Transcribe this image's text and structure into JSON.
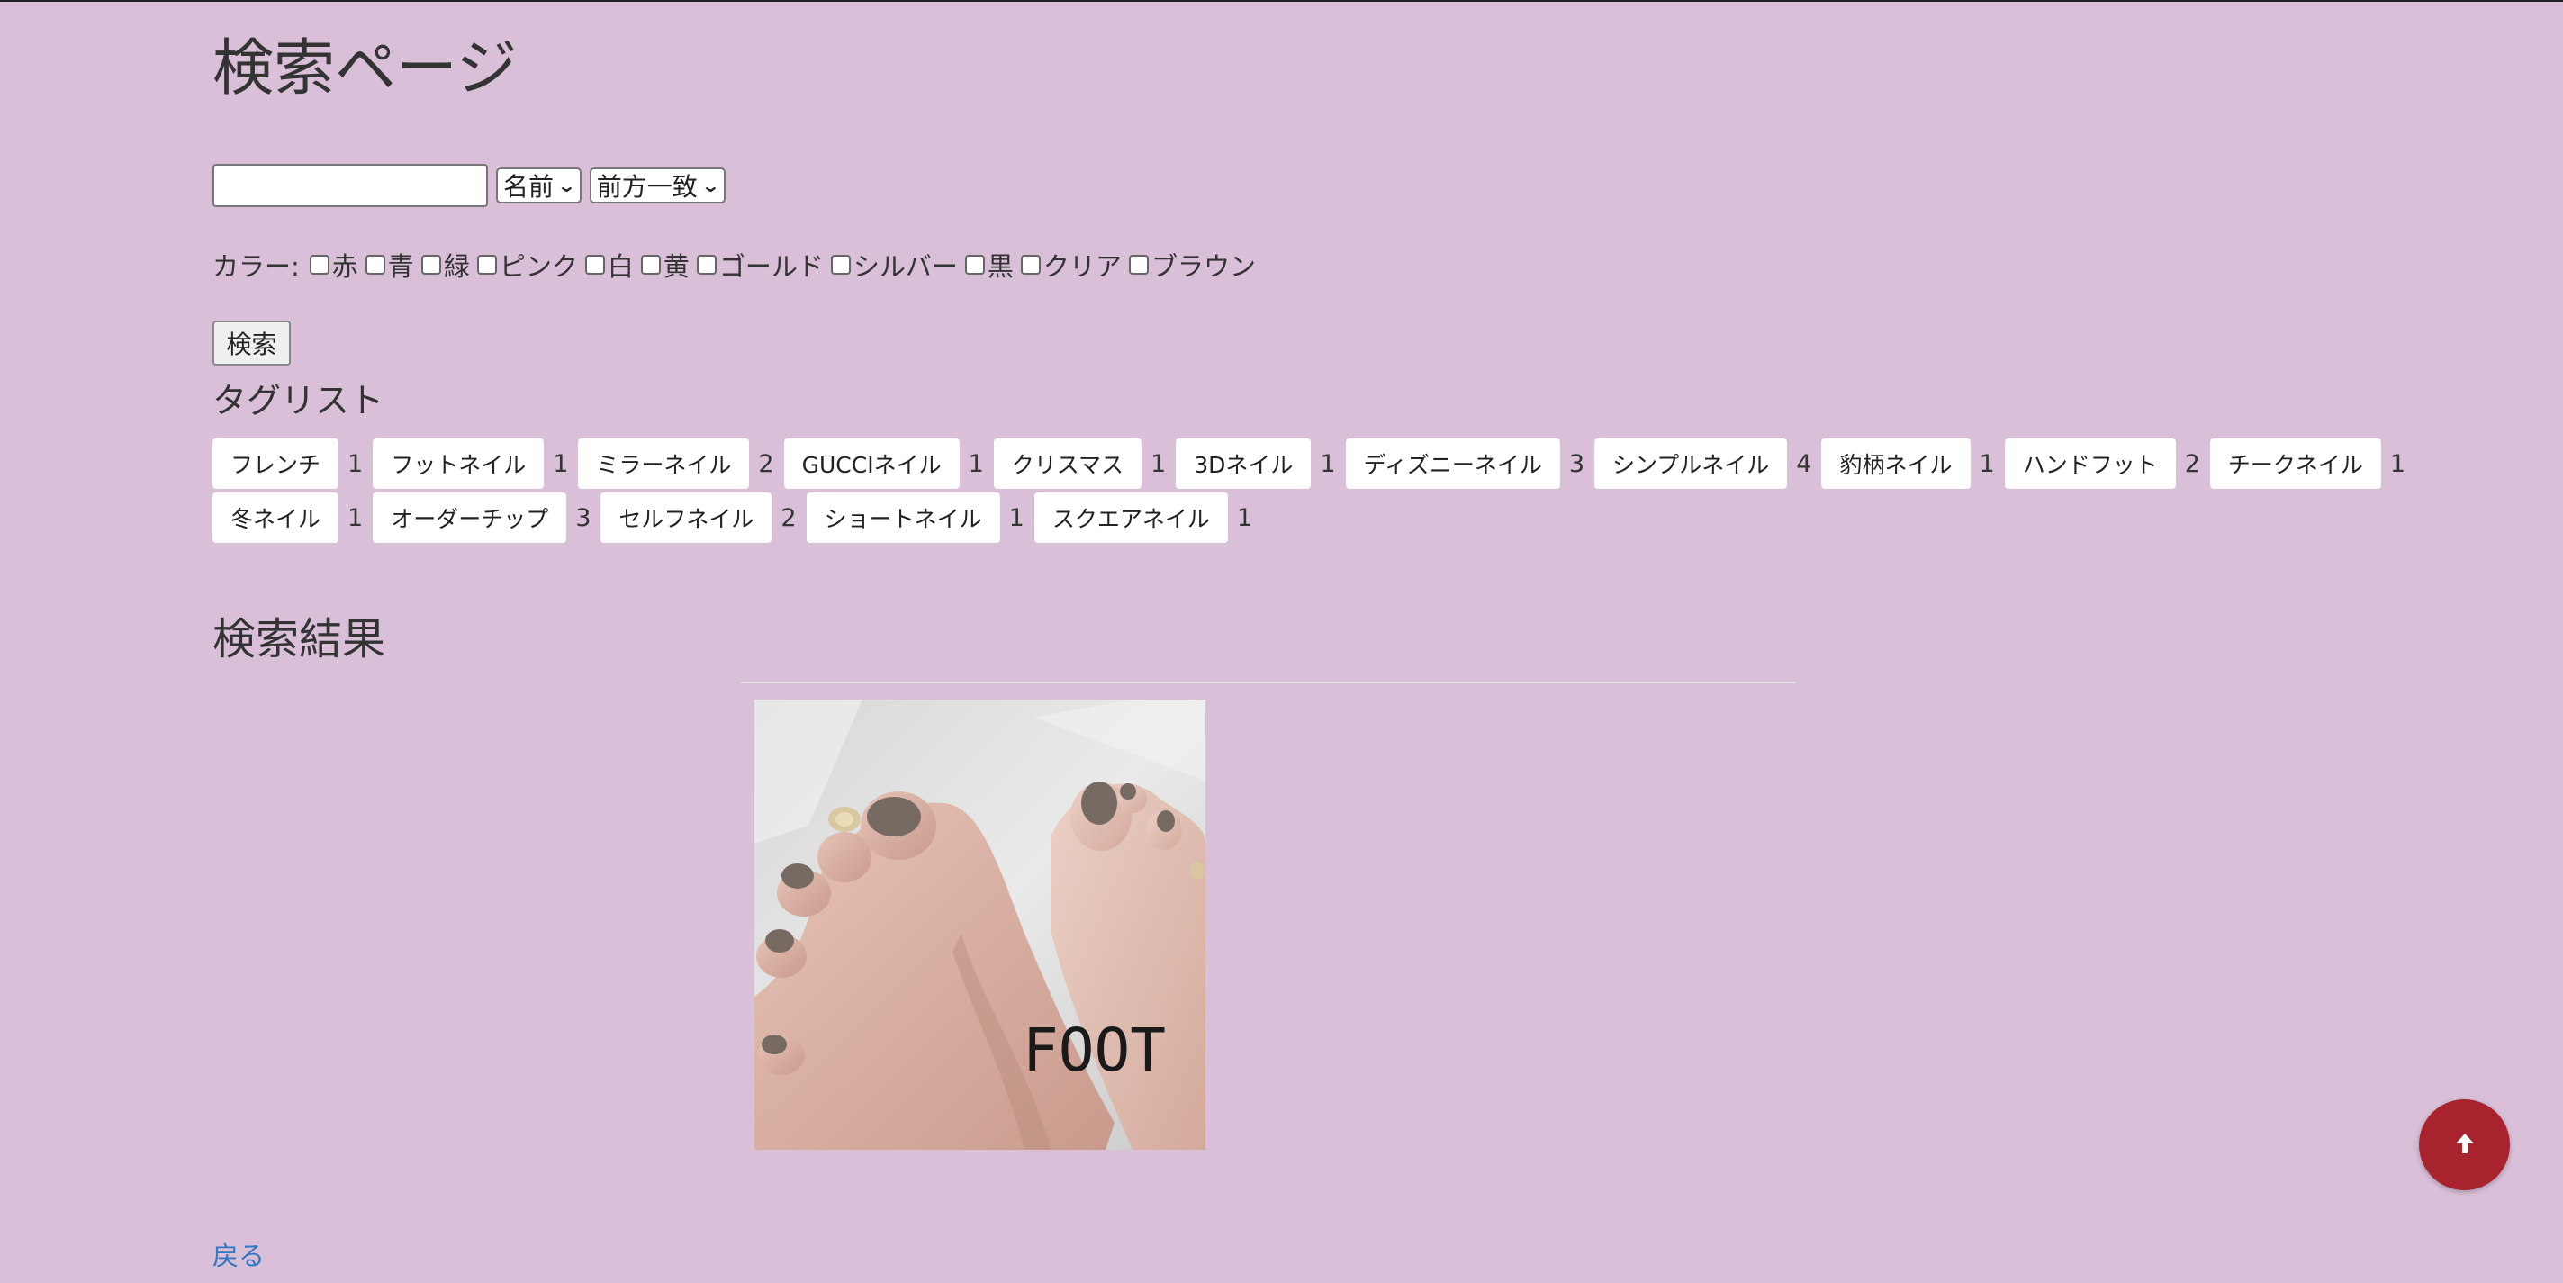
{
  "page": {
    "title": "検索ページ"
  },
  "search": {
    "input_value": "",
    "field_select": "名前",
    "match_select": "前方一致",
    "button_label": "検索"
  },
  "color_filter": {
    "label": "カラー:",
    "options": [
      "赤",
      "青",
      "緑",
      "ピンク",
      "白",
      "黄",
      "ゴールド",
      "シルバー",
      "黒",
      "クリア",
      "ブラウン"
    ]
  },
  "tags": {
    "title": "タグリスト",
    "items": [
      {
        "label": "フレンチ",
        "count": "1"
      },
      {
        "label": "フットネイル",
        "count": "1"
      },
      {
        "label": "ミラーネイル",
        "count": "2"
      },
      {
        "label": "GUCCIネイル",
        "count": "1"
      },
      {
        "label": "クリスマス",
        "count": "1"
      },
      {
        "label": "3Dネイル",
        "count": "1"
      },
      {
        "label": "ディズニーネイル",
        "count": "3"
      },
      {
        "label": "シンプルネイル",
        "count": "4"
      },
      {
        "label": "豹柄ネイル",
        "count": "1"
      },
      {
        "label": "ハンドフット",
        "count": "2"
      },
      {
        "label": "チークネイル",
        "count": "1"
      },
      {
        "label": "冬ネイル",
        "count": "1"
      },
      {
        "label": "オーダーチップ",
        "count": "3"
      },
      {
        "label": "セルフネイル",
        "count": "2"
      },
      {
        "label": "ショートネイル",
        "count": "1"
      },
      {
        "label": "スクエアネイル",
        "count": "1"
      }
    ]
  },
  "results": {
    "title": "検索結果",
    "image_caption": "FOOT NAI"
  },
  "footer": {
    "back_link": "戻る"
  },
  "icons": {
    "scroll_top": "arrow-up-icon"
  },
  "colors": {
    "background": "#d9bfd8",
    "scroll_top_button": "#a8232e",
    "link": "#2f78c4"
  }
}
